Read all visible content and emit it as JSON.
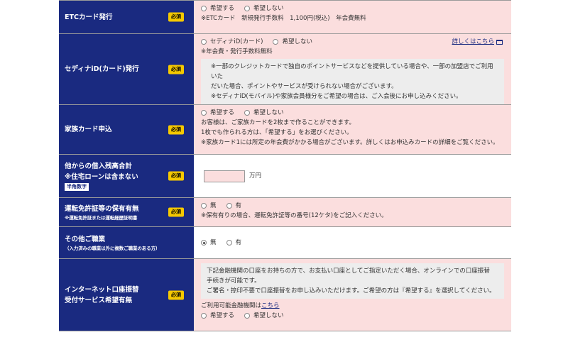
{
  "rows": {
    "etc": {
      "label": "ETCカード発行",
      "badge": "必須",
      "options": [
        "希望する",
        "希望しない"
      ],
      "note": "※ETCカード　新規発行手数料　1,100円(税込)　年会費無料"
    },
    "sedina": {
      "label": "セディナiD(カード)発行",
      "badge": "必須",
      "options": [
        "セディナiD(カード)",
        "希望しない"
      ],
      "note": "※年会費・発行手数料無料",
      "detail_link": "詳しくはこちら",
      "info": [
        "※一部のクレジットカードで独自のポイントサービスなどを提供している場合や、一部の加盟店でご利用いた",
        "だいた場合、ポイントやサービスが受けられない場合がございます。",
        "※セディナiD(モバイル)や家族会員様分をご希望の場合は、ご入会後にお申し込みください。"
      ]
    },
    "family": {
      "label": "家族カード申込",
      "badge": "必須",
      "options": [
        "希望する",
        "希望しない"
      ],
      "lines": [
        "お客様は、ご家族カードを2枚まで作ることができます。",
        "1枚でも作られる方は、「希望する」をお選びください。",
        "※家族カード1には所定の年会費がかかる場合がございます。詳しくはお申込みカードの詳細をご覧ください。"
      ]
    },
    "borrow": {
      "label_line1": "他からの借入残高合計",
      "label_line2": "※住宅ローンは含まない",
      "tag": "半角数字",
      "badge": "必須",
      "unit": "万円"
    },
    "license": {
      "label": "運転免許証等の保有有無",
      "sub": "※運転免許証または運転経歴証明書",
      "badge": "必須",
      "options": [
        "無",
        "有"
      ],
      "note": "※保有有りの場合、運転免許証等の番号(12ケタ)をご記入ください。"
    },
    "job": {
      "label": "その他ご職業",
      "sub": "（入力済みの職業以外に複数ご職業のある方）",
      "options": [
        "無",
        "有"
      ]
    },
    "netbank": {
      "label_line1": "インターネット口座振替",
      "label_line2": "受付サービス希望有無",
      "badge": "必須",
      "info": [
        "下記金融機関の口座をお持ちの方で、お支払い口座としてご指定いただく場合、オンラインでの口座振替",
        "手続きが可能です。",
        "ご署名・捺印不要で口座振替をお申し込みいただけます。ご希望の方は『希望する』を選択してください。"
      ],
      "avail_text": "ご利用可能金融機関は",
      "avail_link": "こちら",
      "options": [
        "希望する",
        "希望しない"
      ]
    }
  }
}
